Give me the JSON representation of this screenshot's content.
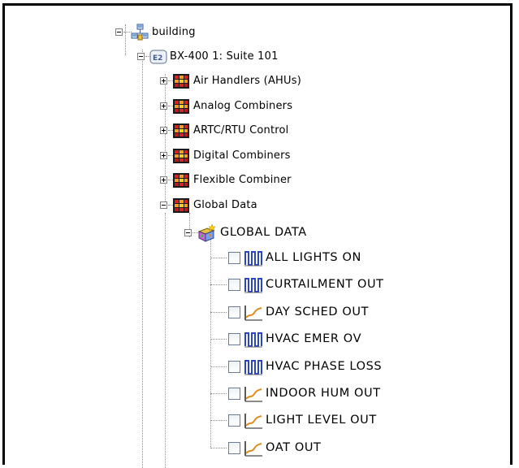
{
  "tree": {
    "root": {
      "label": "building",
      "icon": "network-icon",
      "expanded": true
    },
    "device": {
      "label": "BX-400 1: Suite 101",
      "icon": "device-icon",
      "expanded": true
    },
    "groups": [
      {
        "label": "Air Handlers (AHUs)",
        "expanded": false
      },
      {
        "label": "Analog Combiners",
        "expanded": false
      },
      {
        "label": "ARTC/RTU Control",
        "expanded": false
      },
      {
        "label": "Digital Combiners",
        "expanded": false
      },
      {
        "label": "Flexible Combiner",
        "expanded": false
      },
      {
        "label": "Global Data",
        "expanded": true
      }
    ],
    "global_folder": {
      "label": "GLOBAL DATA",
      "icon": "magic-box-icon",
      "expanded": true
    },
    "points": [
      {
        "label": "ALL LIGHTS ON",
        "type": "digital",
        "icon": "digital-pulse-icon",
        "checked": false
      },
      {
        "label": "CURTAILMENT OUT",
        "type": "digital",
        "icon": "digital-pulse-icon",
        "checked": false
      },
      {
        "label": "DAY SCHED OUT",
        "type": "analog",
        "icon": "analog-trend-icon",
        "checked": false
      },
      {
        "label": "HVAC EMER OV",
        "type": "digital",
        "icon": "digital-pulse-icon",
        "checked": false
      },
      {
        "label": "HVAC PHASE LOSS",
        "type": "digital",
        "icon": "digital-pulse-icon",
        "checked": false
      },
      {
        "label": "INDOOR HUM OUT",
        "type": "analog",
        "icon": "analog-trend-icon",
        "checked": false
      },
      {
        "label": "LIGHT LEVEL OUT",
        "type": "analog",
        "icon": "analog-trend-icon",
        "checked": false
      },
      {
        "label": "OAT OUT",
        "type": "analog",
        "icon": "analog-trend-icon",
        "checked": false
      }
    ]
  },
  "colors": {
    "digital_icon": "#2a46c4",
    "analog_icon": "#e08a1a",
    "checkbox_border": "#6b7d94",
    "tree_lines": "#8a8a8a",
    "frame_border": "#000000"
  }
}
